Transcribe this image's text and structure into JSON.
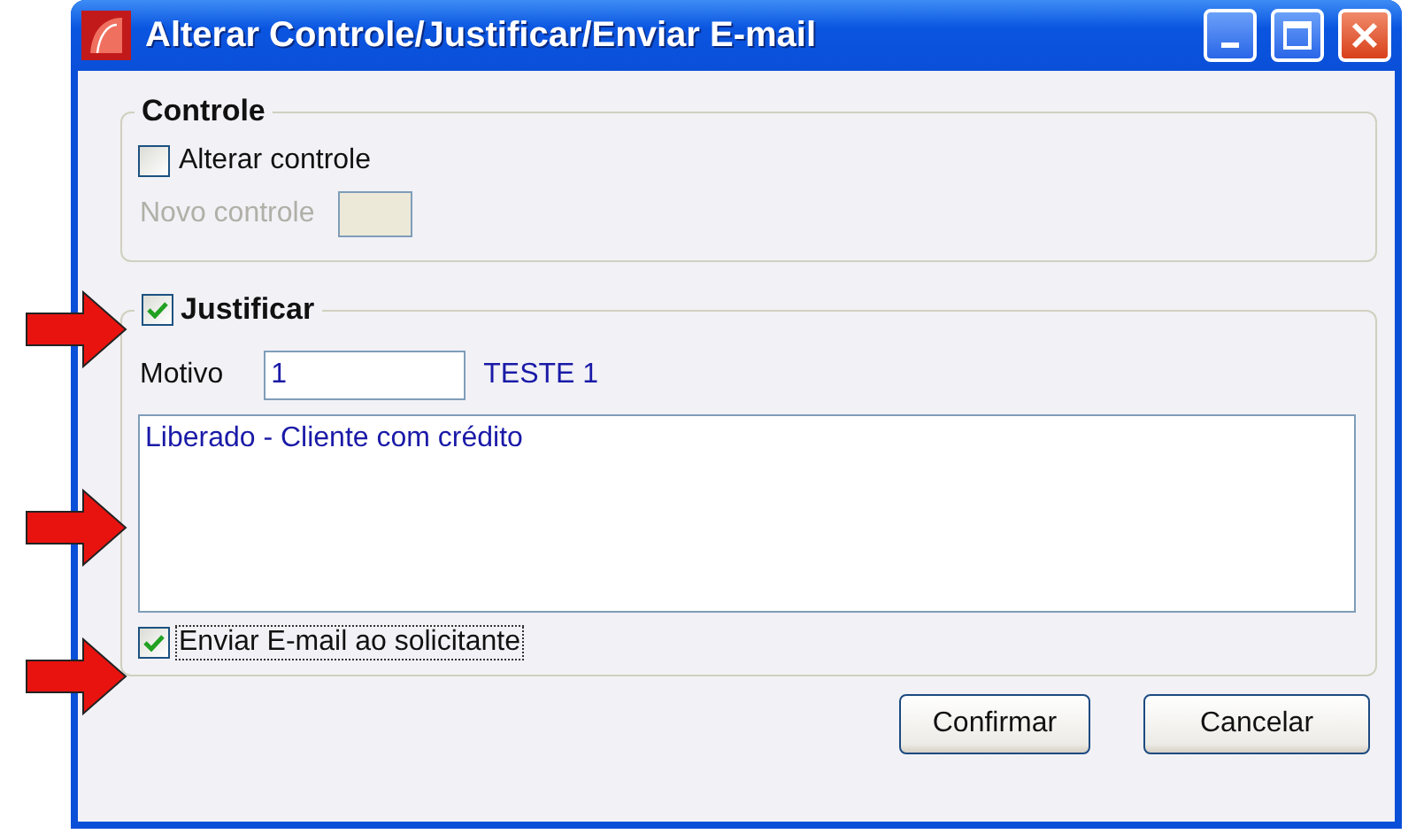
{
  "window": {
    "title": "Alterar Controle/Justificar/Enviar E-mail"
  },
  "controle": {
    "title": "Controle",
    "alterar": {
      "label": "Alterar controle",
      "checked": false
    },
    "novo_controle": {
      "label": "Novo controle",
      "disabled": true
    }
  },
  "justificar": {
    "label": "Justificar",
    "checked": true,
    "motivo": {
      "label": "Motivo",
      "value": "1",
      "description": "TESTE 1"
    },
    "text": "Liberado - Cliente com crédito",
    "email": {
      "label": "Enviar E-mail ao solicitante",
      "checked": true,
      "focused": true
    }
  },
  "buttons": [
    {
      "label": "Confirmar"
    },
    {
      "label": "Cancelar"
    }
  ]
}
